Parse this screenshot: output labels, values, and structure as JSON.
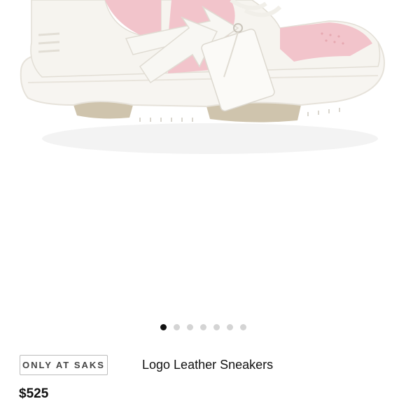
{
  "product": {
    "badge": "ONLY AT SAKS",
    "name": "Logo Leather Sneakers",
    "price": "$525"
  },
  "carousel": {
    "total_images": 7,
    "active_index": 0
  },
  "colors": {
    "sneaker_pink": "#f2c4cb",
    "sneaker_white": "#f6f4ef",
    "sole_gum": "#c8bca4",
    "active_dot": "#111111",
    "inactive_dot": "#d4d4d4"
  }
}
